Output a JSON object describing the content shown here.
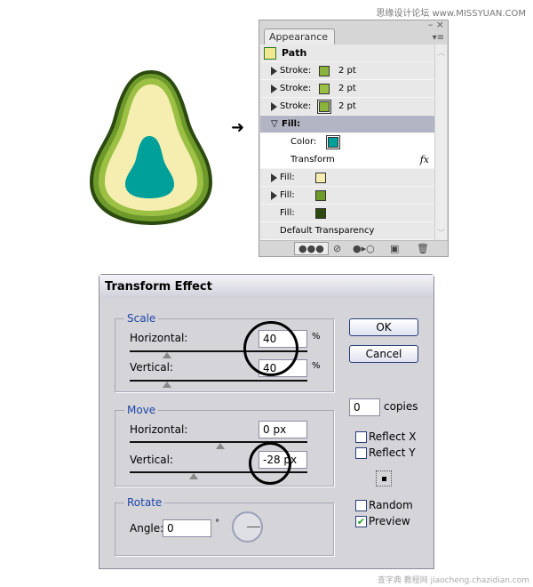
{
  "watermark_top": "思缘设计论坛 www.MISSYUAN.COM",
  "watermark_bottom": "查字典 教程网 jiaocheng.chazidian.com",
  "appearance": {
    "tab_label": "Appearance",
    "tab_close": "×",
    "path_label": "Path",
    "rows": [
      {
        "label": "Stroke:",
        "value": "2 pt",
        "color": "#8cb43c"
      },
      {
        "label": "Stroke:",
        "value": "2 pt",
        "color": "#9cc044"
      },
      {
        "label": "Stroke:",
        "value": "2 pt",
        "color": "#8cb43c"
      }
    ],
    "fill_header": "Fill:",
    "color_label": "Color:",
    "fill_color": "#00a09a",
    "transform_label": "Transform",
    "fx": "fx",
    "fills": [
      {
        "label": "Fill:",
        "color": "#f5eeb0"
      },
      {
        "label": "Fill:",
        "color": "#6e9a2c"
      },
      {
        "label": "Fill:",
        "color": "#2c4a10"
      }
    ],
    "default_transparency": "Default Transparency"
  },
  "dialog": {
    "title": "Transform Effect",
    "scale": {
      "legend": "Scale",
      "horizontal_label": "Horizontal:",
      "horizontal": "40",
      "vertical_label": "Vertical:",
      "vertical": "40",
      "unit": "%"
    },
    "move": {
      "legend": "Move",
      "horizontal_label": "Horizontal:",
      "horizontal": "0 px",
      "vertical_label": "Vertical:",
      "vertical": "-28 px"
    },
    "rotate": {
      "legend": "Rotate",
      "angle_label": "Angle:",
      "angle": "0",
      "degree": "°"
    },
    "ok": "OK",
    "cancel": "Cancel",
    "copies": "0",
    "copies_label": "copies",
    "reflect_x": "Reflect X",
    "reflect_y": "Reflect Y",
    "random": "Random",
    "preview": "Preview",
    "reflect_x_checked": false,
    "reflect_y_checked": false,
    "random_checked": false,
    "preview_checked": true
  }
}
